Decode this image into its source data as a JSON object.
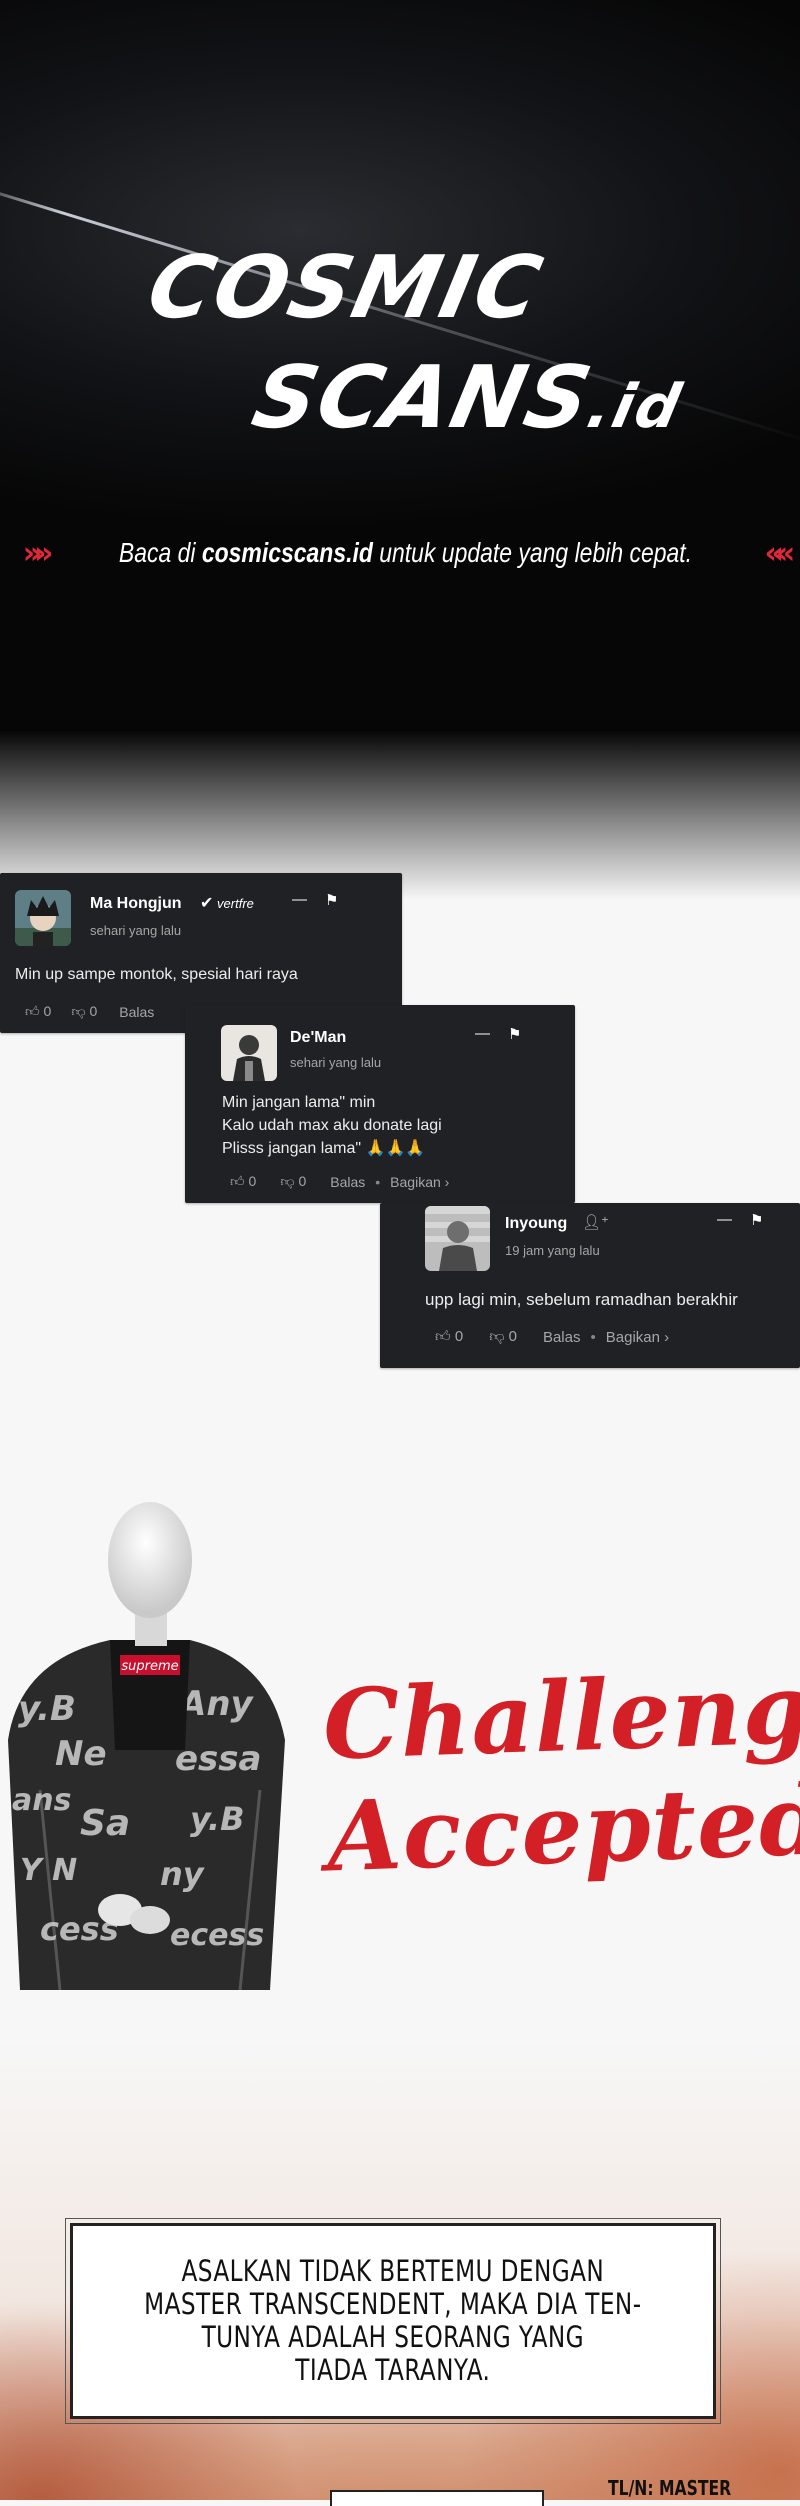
{
  "banner": {
    "logo_line1": "COSMIC",
    "logo_line2": "SCANS",
    "logo_suffix": ".id",
    "tagline_pre": "Baca di ",
    "tagline_site": "cosmicscans.id",
    "tagline_post": " untuk update yang lebih cepat.",
    "chevrons_left": "»»",
    "chevrons_right": "««"
  },
  "comments": [
    {
      "username": "Ma Hongjun",
      "badge": "vertfre",
      "time": "sehari yang lalu",
      "text": "Min up sampe montok, spesial hari raya",
      "likes": "0",
      "dislikes": "0",
      "reply": "Balas",
      "share": ""
    },
    {
      "username": "De'Man",
      "badge": "",
      "time": "sehari yang lalu",
      "text": "Min jangan lama\" min\nKalo udah max aku donate lagi\nPlisss jangan lama\" 🙏🙏🙏",
      "likes": "0",
      "dislikes": "0",
      "reply": "Balas",
      "share": "Bagikan ›"
    },
    {
      "username": "Inyoung",
      "badge": "",
      "time": "19 jam yang lalu",
      "text": "upp lagi min, sebelum ramadhan berakhir",
      "likes": "0",
      "dislikes": "0",
      "reply": "Balas",
      "share": "Bagikan ›"
    }
  ],
  "meme": {
    "line1": "Challenge",
    "line2": "Accepted!",
    "jacket_text": "supreme"
  },
  "panel": {
    "dialog": "ASALKAN TIDAK BERTEMU DENGAN\nMASTER TRANSCENDENT, MAKA DIA TEN-\nTUNYA ADALAH SEORANG YANG\nTIADA TARANYA.",
    "credit": "TL/N: MASTER"
  },
  "colors": {
    "accent_red": "#d31f26",
    "chevron_red": "#e0283a",
    "card_bg": "#202124"
  }
}
